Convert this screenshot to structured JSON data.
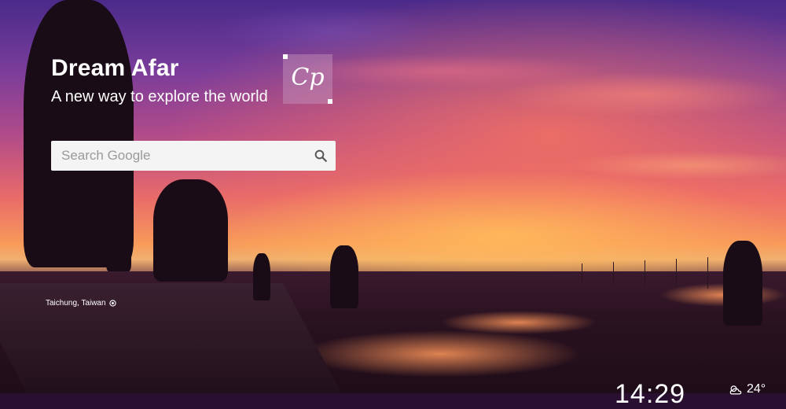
{
  "brand": {
    "title": "Dream Afar",
    "subtitle": "A new way to explore the world"
  },
  "logo": {
    "text": "Cp"
  },
  "search": {
    "placeholder": "Search Google",
    "value": "",
    "icon": "search-icon"
  },
  "photo": {
    "location": "Taichung, Taiwan",
    "location_icon": "location-target-icon"
  },
  "clock": {
    "time": "14:29"
  },
  "weather": {
    "temperature": "24°",
    "icon": "partly-cloudy-icon"
  },
  "colors": {
    "search_bg": "#f4f4f4",
    "text": "#ffffff",
    "sky_top": "#4a2a8a",
    "horizon": "#f89a5a"
  }
}
